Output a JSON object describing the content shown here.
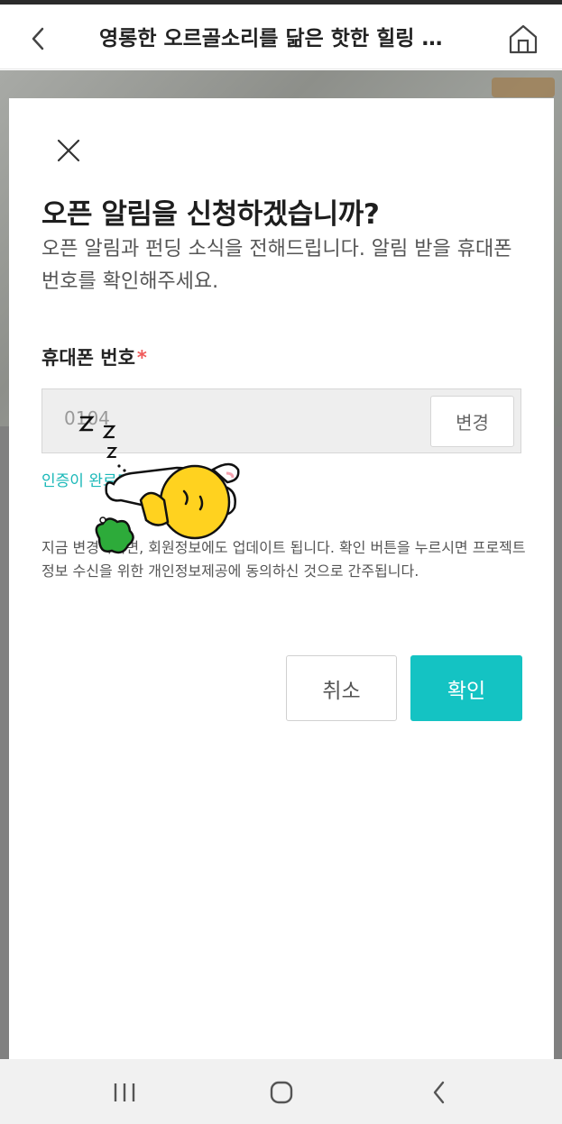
{
  "header": {
    "title": "영롱한 오르골소리를 닮은 핫한 힐링 아이템"
  },
  "icons": {
    "back": "chevron-left-icon",
    "home": "home-icon",
    "close": "close-icon",
    "recents": "recents-icon",
    "nav_home": "circle-home-icon",
    "nav_back": "nav-back-icon"
  },
  "modal": {
    "title": "오픈 알림을 신청하겠습니까?",
    "description": "오픈 알림과 펀딩 소식을 전해드립니다. 알림 받을 휴대폰 번호를 확인해주세요.",
    "field_label": "휴대폰 번호",
    "required_mark": "*",
    "phone_value": "0104",
    "change_label": "변경",
    "verified_text": "인증이 완료되었습니다.",
    "notice": "지금 변경하시면, 회원정보에도 업데이트 됩니다. 확인 버튼을 누르시면 프로젝트 정보 수신을 위한 개인정보제공에 동의하신 것으로 간주됩니다.",
    "cancel_label": "취소",
    "confirm_label": "확인"
  },
  "colors": {
    "accent": "#14c3c3",
    "verified": "#1ab8b8",
    "required": "#f05a5a"
  }
}
